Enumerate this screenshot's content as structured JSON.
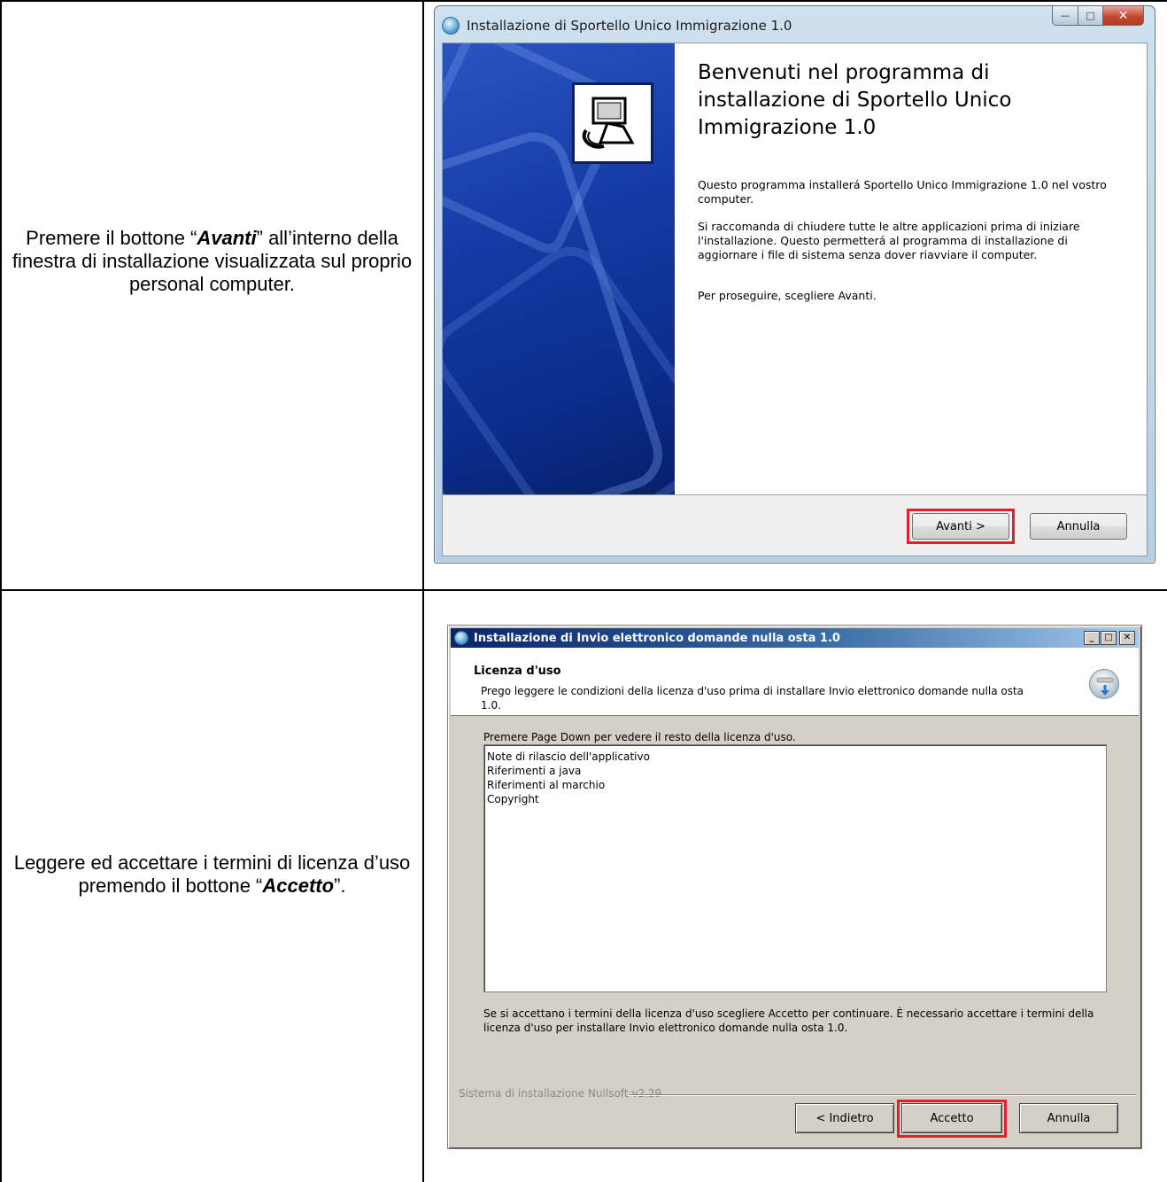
{
  "row1": {
    "instruction_before": "Premere il bottone “",
    "instruction_emph": "Avanti",
    "instruction_after": "” all’interno della finestra di installazione visualizzata sul proprio personal computer.",
    "window": {
      "title": "Installazione di Sportello Unico Immigrazione 1.0",
      "heading": "Benvenuti nel programma di installazione di Sportello Unico Immigrazione 1.0",
      "paragraphs": [
        "Questo programma installerá Sportello Unico Immigrazione 1.0 nel vostro computer.",
        "Si raccomanda di chiudere tutte le altre applicazioni prima di iniziare l'installazione. Questo permetterá al programma di installazione di aggiornare i file di sistema senza dover riavviare il computer.",
        "Per proseguire, scegliere Avanti."
      ],
      "next_button": "Avanti >",
      "cancel_button": "Annulla"
    }
  },
  "row2": {
    "instruction_before": "Leggere ed accettare i termini di licenza d’uso premendo il bottone “",
    "instruction_emph": "Accetto",
    "instruction_after": "”.",
    "window": {
      "title": "Installazione di Invio elettronico domande nulla osta 1.0",
      "header_title": "Licenza d'uso",
      "header_subtitle": "Prego leggere le condizioni della licenza d'uso prima di installare Invio elettronico domande nulla osta 1.0.",
      "page_down_hint": "Premere Page Down per vedere il resto della licenza d'uso.",
      "license_lines": [
        "Note di rilascio dell'applicativo",
        "Riferimenti a java",
        "Riferimenti al marchio",
        "Copyright"
      ],
      "accept_text": "Se si accettano i termini della licenza d'uso scegliere Accetto per continuare. È necessario accettare i termini della licenza d'uso per installare Invio elettronico domande nulla osta 1.0.",
      "branding": "Sistema di installazione Nullsoft v2.29",
      "back_button": "< Indietro",
      "accept_button": "Accetto",
      "cancel_button": "Annulla"
    }
  },
  "colors": {
    "highlight": "#e0202a",
    "vista_side": "#143ba6",
    "classic_title": "#0a246a"
  }
}
